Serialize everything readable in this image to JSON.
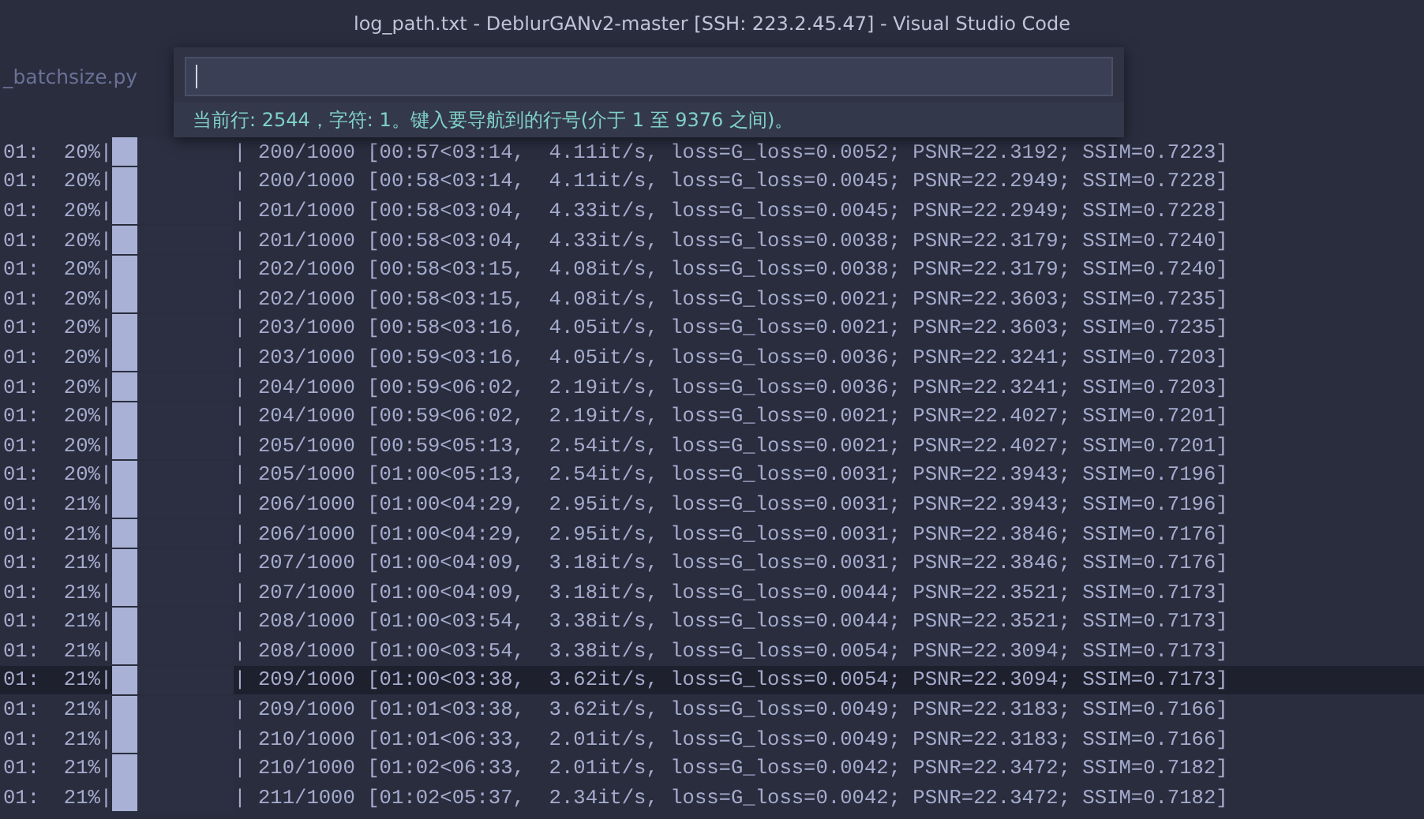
{
  "window": {
    "title": "log_path.txt - DeblurGANv2-master [SSH: 223.2.45.47] - Visual Studio Code"
  },
  "tabs": [
    {
      "label": "_batchsize.py",
      "selected": false
    }
  ],
  "goto_line": {
    "message": "当前行: 2544，字符: 1。键入要导航到的行号(介于 1 至 9376 之间)。"
  },
  "lines": [
    {
      "prefix": "01:",
      "percent": "20%|",
      "level": 0.2,
      "stats": "| 200/1000 [00:57<03:14,  4.11it/s, loss=G_loss=0.0052; PSNR=22.3192; SSIM=0.7223]",
      "current": false
    },
    {
      "prefix": "01:",
      "percent": "20%|",
      "level": 0.2,
      "stats": "| 200/1000 [00:58<03:14,  4.11it/s, loss=G_loss=0.0045; PSNR=22.2949; SSIM=0.7228]",
      "current": false
    },
    {
      "prefix": "01:",
      "percent": "20%|",
      "level": 0.2,
      "stats": "| 201/1000 [00:58<03:04,  4.33it/s, loss=G_loss=0.0045; PSNR=22.2949; SSIM=0.7228]",
      "current": false
    },
    {
      "prefix": "01:",
      "percent": "20%|",
      "level": 0.2,
      "stats": "| 201/1000 [00:58<03:04,  4.33it/s, loss=G_loss=0.0038; PSNR=22.3179; SSIM=0.7240]",
      "current": false
    },
    {
      "prefix": "01:",
      "percent": "20%|",
      "level": 0.2,
      "stats": "| 202/1000 [00:58<03:15,  4.08it/s, loss=G_loss=0.0038; PSNR=22.3179; SSIM=0.7240]",
      "current": false
    },
    {
      "prefix": "01:",
      "percent": "20%|",
      "level": 0.2,
      "stats": "| 202/1000 [00:58<03:15,  4.08it/s, loss=G_loss=0.0021; PSNR=22.3603; SSIM=0.7235]",
      "current": false
    },
    {
      "prefix": "01:",
      "percent": "20%|",
      "level": 0.2,
      "stats": "| 203/1000 [00:58<03:16,  4.05it/s, loss=G_loss=0.0021; PSNR=22.3603; SSIM=0.7235]",
      "current": false
    },
    {
      "prefix": "01:",
      "percent": "20%|",
      "level": 0.2,
      "stats": "| 203/1000 [00:59<03:16,  4.05it/s, loss=G_loss=0.0036; PSNR=22.3241; SSIM=0.7203]",
      "current": false
    },
    {
      "prefix": "01:",
      "percent": "20%|",
      "level": 0.2,
      "stats": "| 204/1000 [00:59<06:02,  2.19it/s, loss=G_loss=0.0036; PSNR=22.3241; SSIM=0.7203]",
      "current": false
    },
    {
      "prefix": "01:",
      "percent": "20%|",
      "level": 0.2,
      "stats": "| 204/1000 [00:59<06:02,  2.19it/s, loss=G_loss=0.0021; PSNR=22.4027; SSIM=0.7201]",
      "current": false
    },
    {
      "prefix": "01:",
      "percent": "20%|",
      "level": 0.2,
      "stats": "| 205/1000 [00:59<05:13,  2.54it/s, loss=G_loss=0.0021; PSNR=22.4027; SSIM=0.7201]",
      "current": false
    },
    {
      "prefix": "01:",
      "percent": "20%|",
      "level": 0.2,
      "stats": "| 205/1000 [01:00<05:13,  2.54it/s, loss=G_loss=0.0031; PSNR=22.3943; SSIM=0.7196]",
      "current": false
    },
    {
      "prefix": "01:",
      "percent": "21%|",
      "level": 0.2,
      "stats": "| 206/1000 [01:00<04:29,  2.95it/s, loss=G_loss=0.0031; PSNR=22.3943; SSIM=0.7196]",
      "current": false
    },
    {
      "prefix": "01:",
      "percent": "21%|",
      "level": 0.2,
      "stats": "| 206/1000 [01:00<04:29,  2.95it/s, loss=G_loss=0.0031; PSNR=22.3846; SSIM=0.7176]",
      "current": false
    },
    {
      "prefix": "01:",
      "percent": "21%|",
      "level": 0.2,
      "stats": "| 207/1000 [01:00<04:09,  3.18it/s, loss=G_loss=0.0031; PSNR=22.3846; SSIM=0.7176]",
      "current": false
    },
    {
      "prefix": "01:",
      "percent": "21%|",
      "level": 0.2,
      "stats": "| 207/1000 [01:00<04:09,  3.18it/s, loss=G_loss=0.0044; PSNR=22.3521; SSIM=0.7173]",
      "current": false
    },
    {
      "prefix": "01:",
      "percent": "21%|",
      "level": 0.2,
      "stats": "| 208/1000 [01:00<03:54,  3.38it/s, loss=G_loss=0.0044; PSNR=22.3521; SSIM=0.7173]",
      "current": false
    },
    {
      "prefix": "01:",
      "percent": "21%|",
      "level": 0.2,
      "stats": "| 208/1000 [01:00<03:54,  3.38it/s, loss=G_loss=0.0054; PSNR=22.3094; SSIM=0.7173]",
      "current": false
    },
    {
      "prefix": "01:",
      "percent": "21%|",
      "level": 0.2,
      "stats": "| 209/1000 [01:00<03:38,  3.62it/s, loss=G_loss=0.0054; PSNR=22.3094; SSIM=0.7173]",
      "current": true
    },
    {
      "prefix": "01:",
      "percent": "21%|",
      "level": 0.2,
      "stats": "| 209/1000 [01:01<03:38,  3.62it/s, loss=G_loss=0.0049; PSNR=22.3183; SSIM=0.7166]",
      "current": false
    },
    {
      "prefix": "01:",
      "percent": "21%|",
      "level": 0.2,
      "stats": "| 210/1000 [01:01<06:33,  2.01it/s, loss=G_loss=0.0049; PSNR=22.3183; SSIM=0.7166]",
      "current": false
    },
    {
      "prefix": "01:",
      "percent": "21%|",
      "level": 0.2,
      "stats": "| 210/1000 [01:02<06:33,  2.01it/s, loss=G_loss=0.0042; PSNR=22.3472; SSIM=0.7182]",
      "current": false
    },
    {
      "prefix": "01:",
      "percent": "21%|",
      "level": 0.2,
      "stats": "| 211/1000 [01:02<05:37,  2.34it/s, loss=G_loss=0.0042; PSNR=22.3472; SSIM=0.7182]",
      "current": false
    }
  ]
}
